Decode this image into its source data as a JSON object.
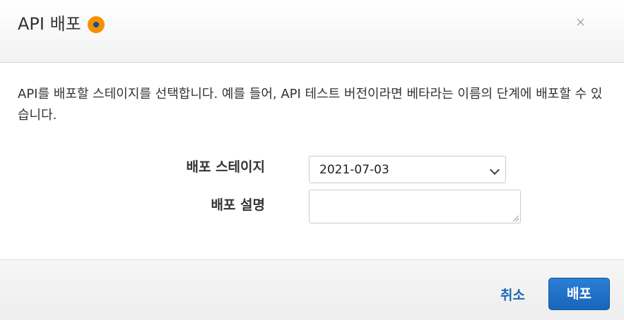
{
  "dialog": {
    "title": "API 배포",
    "close_label": "×",
    "description": "API를 배포할 스테이지를 선택합니다. 예를 들어, API 테스트 버전이라면 베타라는 이름의 단계에 배포할 수 있습니다.",
    "form": {
      "stage_label": "배포 스테이지",
      "stage_value": "2021-07-03",
      "description_label": "배포 설명",
      "description_value": ""
    },
    "footer": {
      "cancel_label": "취소",
      "deploy_label": "배포"
    }
  },
  "colors": {
    "info_icon": "#f29100",
    "primary_button": "#1766bb",
    "link": "#1e6ab4"
  },
  "icons": {
    "title_icon": "info-icon",
    "select_icon": "chevron-down-icon",
    "close_icon": "close-icon"
  }
}
